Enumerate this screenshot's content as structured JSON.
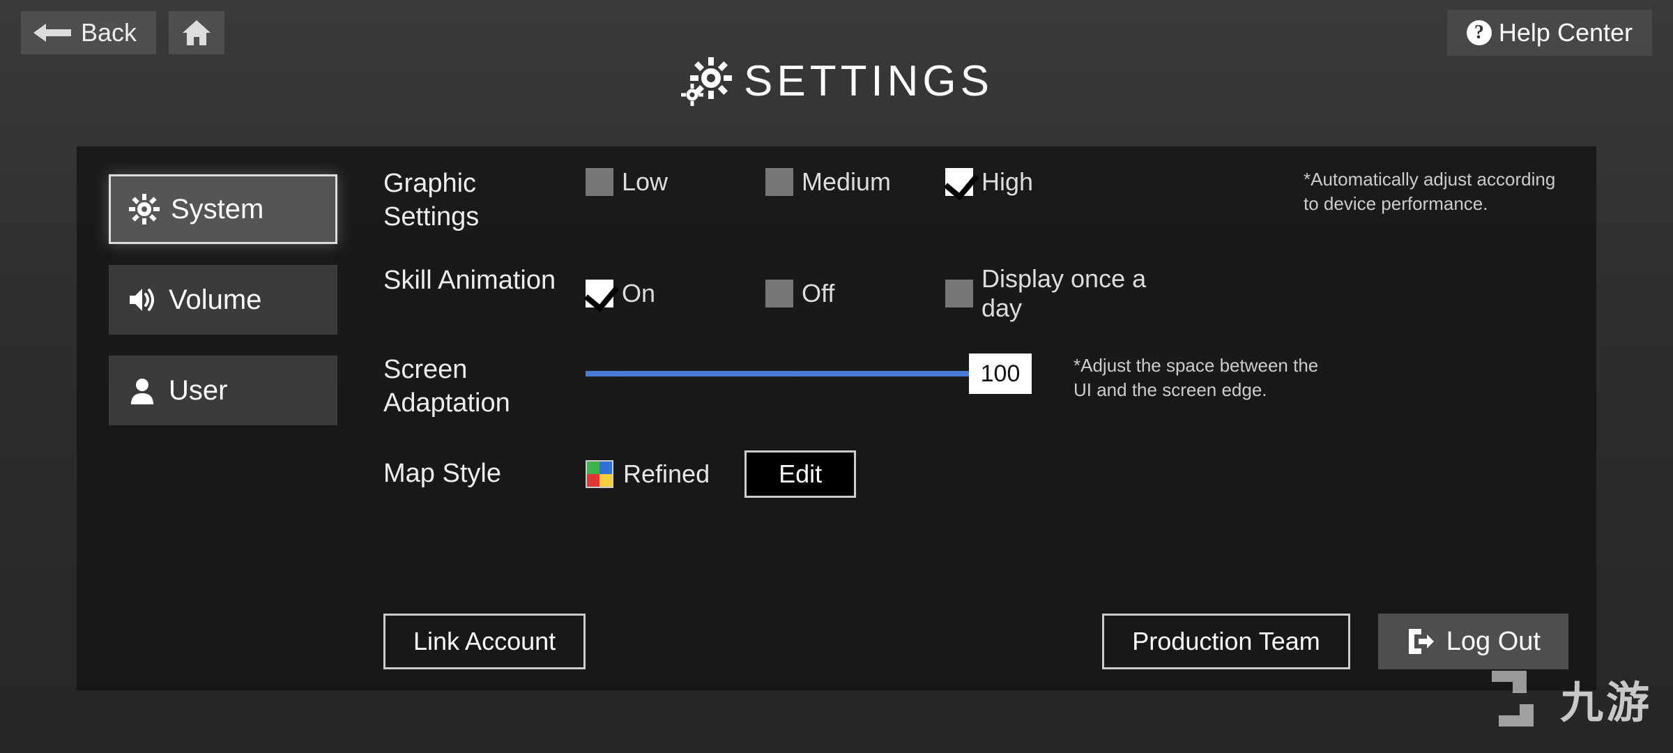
{
  "topbar": {
    "back_label": "Back",
    "help_label": "Help Center"
  },
  "title": "SETTINGS",
  "sidebar": {
    "items": [
      {
        "label": "System",
        "active": true
      },
      {
        "label": "Volume",
        "active": false
      },
      {
        "label": "User",
        "active": false
      }
    ]
  },
  "settings": {
    "graphic": {
      "label": "Graphic Settings",
      "options": {
        "low": "Low",
        "medium": "Medium",
        "high": "High"
      },
      "selected": "high",
      "hint": "*Automatically adjust according to device performance."
    },
    "skill_anim": {
      "label": "Skill Animation",
      "options": {
        "on": "On",
        "off": "Off",
        "daily": "Display once a day"
      },
      "selected": "on"
    },
    "screen_adapt": {
      "label": "Screen Adaptation",
      "value": "100",
      "hint": "*Adjust the space between the UI and the screen edge."
    },
    "map_style": {
      "label": "Map Style",
      "value": "Refined",
      "edit_label": "Edit"
    }
  },
  "buttons": {
    "link_account": "Link Account",
    "production_team": "Production Team",
    "log_out": "Log Out"
  },
  "watermark": "九游"
}
